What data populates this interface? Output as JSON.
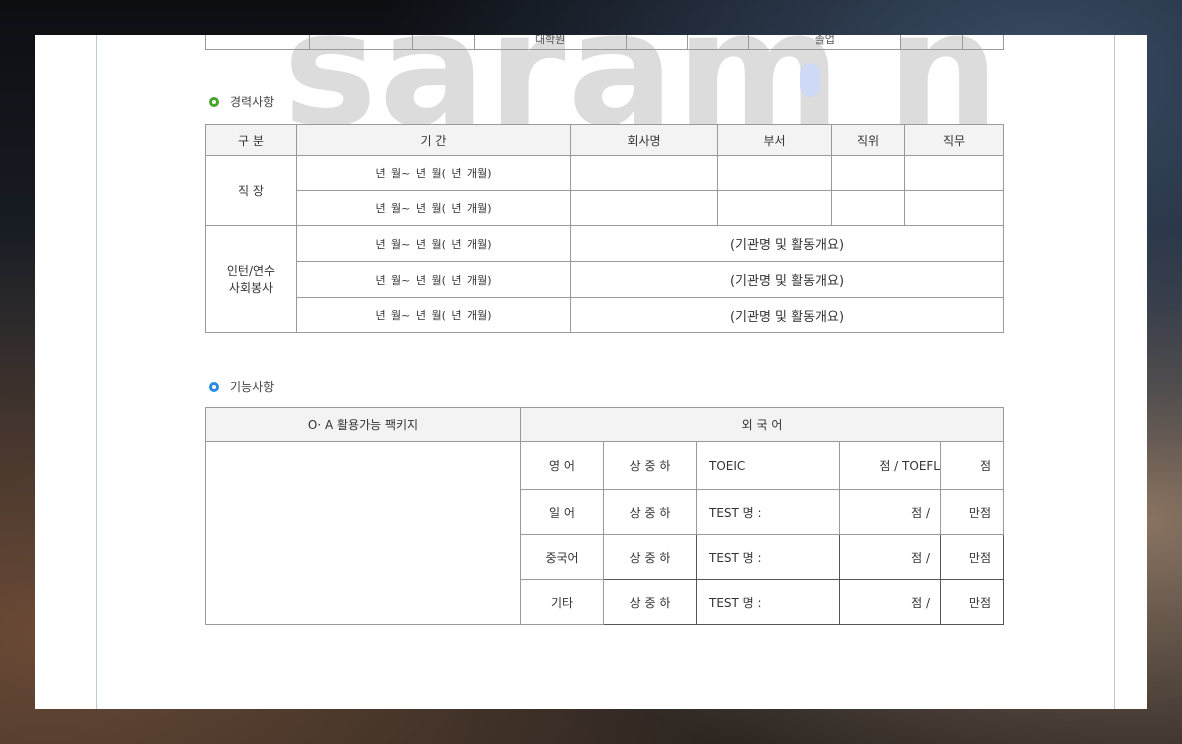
{
  "watermark": {
    "text": "saram",
    "tail": "n"
  },
  "top_stub": {
    "cells": [
      "",
      "",
      "",
      "대학원",
      "",
      "",
      "졸업",
      "",
      ""
    ]
  },
  "career": {
    "section_title": "경력사항",
    "headers": [
      "구 분",
      "기 간",
      "회사명",
      "부서",
      "직위",
      "직무"
    ],
    "workplace_label": "직 장",
    "intern_label_1": "인턴/연수",
    "intern_label_2": "사회봉사",
    "period": "년  월~  년  월( 년  개월)",
    "activity": "(기관명 및 활동개요)"
  },
  "skills": {
    "section_title": "기능사항",
    "oa_header": "O· A 활용가능 팩키지",
    "foreign_header": "외    국    어",
    "level": "상 중 하",
    "rows": [
      {
        "lang": "영 어",
        "test": "TOEIC",
        "score": "점 / TOEFL",
        "full": "점"
      },
      {
        "lang": "일 어",
        "test": "TEST 명 :",
        "score": "점 /",
        "full": "만점"
      },
      {
        "lang": "중국어",
        "test": "TEST 명 :",
        "score": "점 /",
        "full": "만점"
      },
      {
        "lang": "기타",
        "test": "TEST 명 :",
        "score": "점 /",
        "full": "만점"
      }
    ]
  }
}
